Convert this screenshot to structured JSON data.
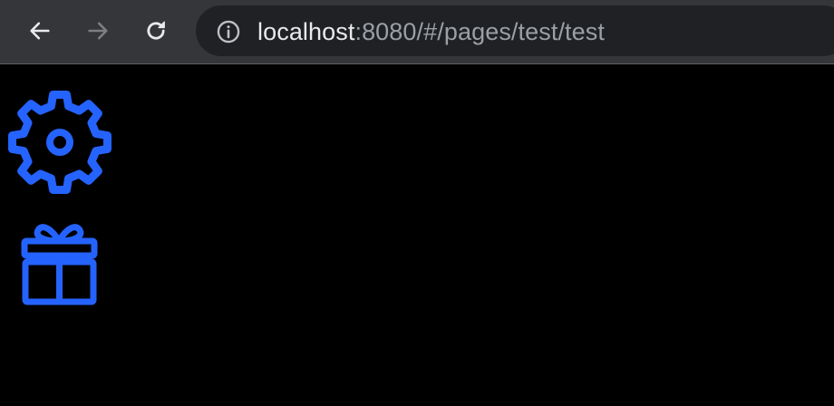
{
  "browser": {
    "back_icon": "arrow-left-icon",
    "forward_icon": "arrow-right-icon",
    "reload_icon": "reload-icon",
    "info_icon": "info-circle-icon",
    "url_host": "localhost",
    "url_rest": ":8080/#/pages/test/test",
    "forward_disabled": true
  },
  "page": {
    "icons": [
      {
        "name": "gear-icon",
        "color": "#2563ff"
      },
      {
        "name": "gift-icon",
        "color": "#2563ff"
      }
    ]
  }
}
